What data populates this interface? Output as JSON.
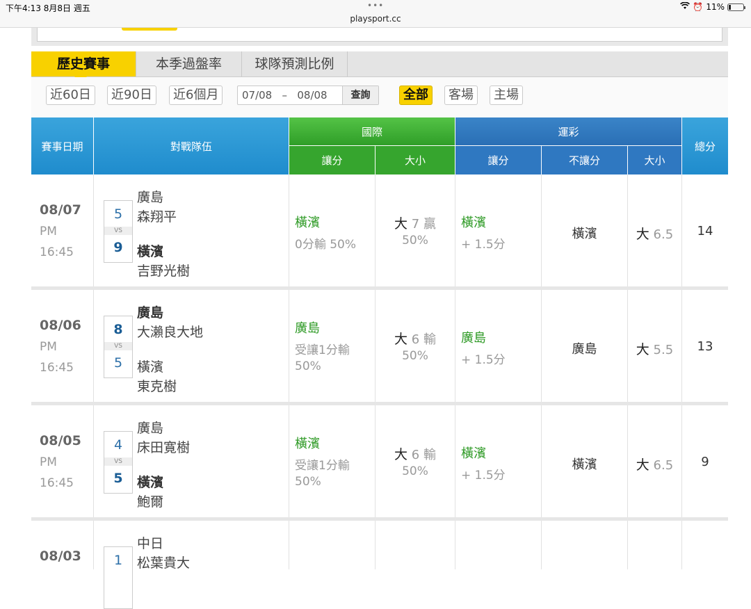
{
  "status_bar": {
    "time_date": "下午4:13   8月8日 週五",
    "url": "playsport.cc",
    "battery": "11%"
  },
  "tabs": [
    "歷史賽事",
    "本季過盤率",
    "球隊預測比例"
  ],
  "filters": {
    "ranges": [
      "近60日",
      "近90日",
      "近6個月"
    ],
    "date_from": "07/08",
    "date_sep": "–",
    "date_to": "08/08",
    "query_label": "查詢",
    "venues": [
      "全部",
      "客場",
      "主場"
    ],
    "active_venue": "全部"
  },
  "table": {
    "headers": {
      "date": "賽事日期",
      "teams": "對戰隊伍",
      "intl": "國際",
      "intl_spread": "讓分",
      "intl_total": "大小",
      "yc": "運彩",
      "yc_spread": "讓分",
      "yc_nospread": "不讓分",
      "yc_total": "大小",
      "total": "總分"
    },
    "vs_label": "VS",
    "rows": [
      {
        "date": "08/07",
        "ampm": "PM",
        "time": "16:45",
        "away_team": "廣島",
        "away_pitcher": "森翔平",
        "away_score": "5",
        "home_team": "橫濱",
        "home_pitcher": "吉野光樹",
        "home_score": "9",
        "intl_spread_team": "橫濱",
        "intl_spread_result": "0分輸 50%",
        "intl_total_side": "大",
        "intl_total_line": "7",
        "intl_total_result": "贏",
        "intl_total_pct": "50%",
        "yc_spread_team": "橫濱",
        "yc_spread_line": "+ 1.5分",
        "yc_nospread": "橫濱",
        "yc_total_side": "大",
        "yc_total_line": "6.5",
        "total": "14"
      },
      {
        "date": "08/06",
        "ampm": "PM",
        "time": "16:45",
        "away_team": "廣島",
        "away_pitcher": "大瀨良大地",
        "away_score": "8",
        "home_team": "橫濱",
        "home_pitcher": "東克樹",
        "home_score": "5",
        "intl_spread_team": "廣島",
        "intl_spread_result": "受讓1分輸",
        "intl_spread_pct": "50%",
        "intl_total_side": "大",
        "intl_total_line": "6",
        "intl_total_result": "輸",
        "intl_total_pct": "50%",
        "yc_spread_team": "廣島",
        "yc_spread_line": "+ 1.5分",
        "yc_nospread": "廣島",
        "yc_total_side": "大",
        "yc_total_line": "5.5",
        "total": "13"
      },
      {
        "date": "08/05",
        "ampm": "PM",
        "time": "16:45",
        "away_team": "廣島",
        "away_pitcher": "床田寛樹",
        "away_score": "4",
        "home_team": "橫濱",
        "home_pitcher": "鮑爾",
        "home_score": "5",
        "intl_spread_team": "橫濱",
        "intl_spread_result": "受讓1分輸",
        "intl_spread_pct": "50%",
        "intl_total_side": "大",
        "intl_total_line": "6",
        "intl_total_result": "輸",
        "intl_total_pct": "50%",
        "yc_spread_team": "橫濱",
        "yc_spread_line": "+ 1.5分",
        "yc_nospread": "橫濱",
        "yc_total_side": "大",
        "yc_total_line": "6.5",
        "total": "9"
      },
      {
        "date": "08/03",
        "away_team": "中日",
        "away_pitcher": "松葉貴大",
        "away_score": "1"
      }
    ]
  }
}
